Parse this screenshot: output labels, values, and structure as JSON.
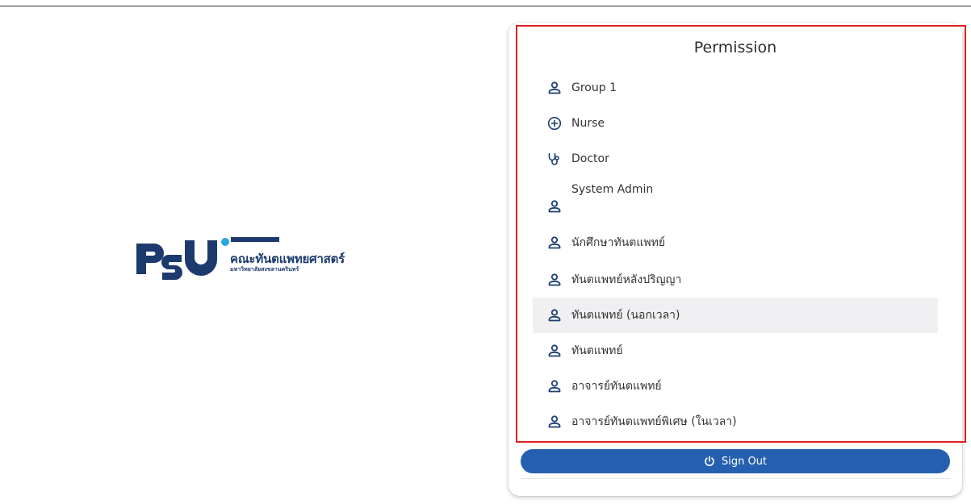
{
  "logo": {
    "mark_text": "PSU",
    "name_th": "คณะทันตแพทยศาสตร์",
    "university_th": "มหาวิทยาลัยสงขลานครินทร์",
    "brand_color": "#1c3a6e",
    "accent_color": "#29a8e0"
  },
  "panel": {
    "title": "Permission",
    "items": [
      {
        "label": "Group 1",
        "icon": "person-icon"
      },
      {
        "label": "Nurse",
        "icon": "plus-circle-icon"
      },
      {
        "label": "Doctor",
        "icon": "stethoscope-icon"
      },
      {
        "label": "System Admin",
        "icon": "person-icon"
      },
      {
        "label": "นักศึกษาทันตแพทย์",
        "icon": "person-icon"
      },
      {
        "label": "ทันตแพทย์หลังปริญญา",
        "icon": "person-icon"
      },
      {
        "label": "ทันตแพทย์ (นอกเวลา)",
        "icon": "person-icon",
        "selected": true
      },
      {
        "label": "ทันตแพทย์",
        "icon": "person-icon"
      },
      {
        "label": "อาจารย์ทันตแพทย์",
        "icon": "person-icon"
      },
      {
        "label": "อาจารย์ทันตแพทย์พิเศษ (ในเวลา)",
        "icon": "person-icon"
      }
    ],
    "sign_out_label": "Sign Out",
    "sign_out_icon": "power-icon"
  },
  "colors": {
    "button": "#2560b0",
    "highlight_border": "#e02020",
    "selected_row": "#f0f0f2",
    "icon": "#1e3f73"
  }
}
